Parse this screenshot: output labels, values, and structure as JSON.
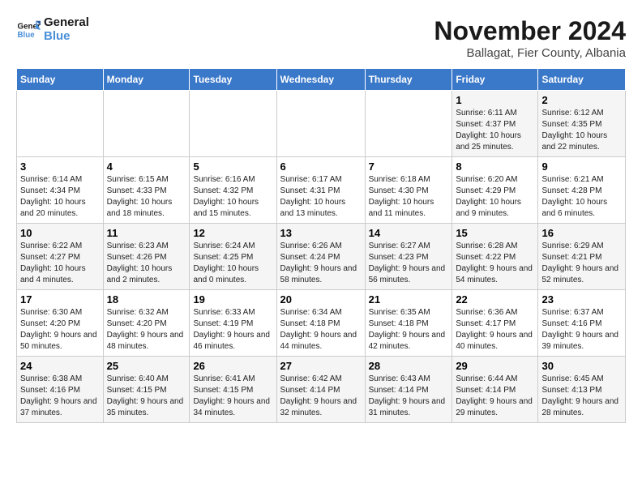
{
  "logo": {
    "line1": "General",
    "line2": "Blue"
  },
  "title": "November 2024",
  "subtitle": "Ballagat, Fier County, Albania",
  "days_header": [
    "Sunday",
    "Monday",
    "Tuesday",
    "Wednesday",
    "Thursday",
    "Friday",
    "Saturday"
  ],
  "weeks": [
    [
      {
        "day": "",
        "info": ""
      },
      {
        "day": "",
        "info": ""
      },
      {
        "day": "",
        "info": ""
      },
      {
        "day": "",
        "info": ""
      },
      {
        "day": "",
        "info": ""
      },
      {
        "day": "1",
        "info": "Sunrise: 6:11 AM\nSunset: 4:37 PM\nDaylight: 10 hours and 25 minutes."
      },
      {
        "day": "2",
        "info": "Sunrise: 6:12 AM\nSunset: 4:35 PM\nDaylight: 10 hours and 22 minutes."
      }
    ],
    [
      {
        "day": "3",
        "info": "Sunrise: 6:14 AM\nSunset: 4:34 PM\nDaylight: 10 hours and 20 minutes."
      },
      {
        "day": "4",
        "info": "Sunrise: 6:15 AM\nSunset: 4:33 PM\nDaylight: 10 hours and 18 minutes."
      },
      {
        "day": "5",
        "info": "Sunrise: 6:16 AM\nSunset: 4:32 PM\nDaylight: 10 hours and 15 minutes."
      },
      {
        "day": "6",
        "info": "Sunrise: 6:17 AM\nSunset: 4:31 PM\nDaylight: 10 hours and 13 minutes."
      },
      {
        "day": "7",
        "info": "Sunrise: 6:18 AM\nSunset: 4:30 PM\nDaylight: 10 hours and 11 minutes."
      },
      {
        "day": "8",
        "info": "Sunrise: 6:20 AM\nSunset: 4:29 PM\nDaylight: 10 hours and 9 minutes."
      },
      {
        "day": "9",
        "info": "Sunrise: 6:21 AM\nSunset: 4:28 PM\nDaylight: 10 hours and 6 minutes."
      }
    ],
    [
      {
        "day": "10",
        "info": "Sunrise: 6:22 AM\nSunset: 4:27 PM\nDaylight: 10 hours and 4 minutes."
      },
      {
        "day": "11",
        "info": "Sunrise: 6:23 AM\nSunset: 4:26 PM\nDaylight: 10 hours and 2 minutes."
      },
      {
        "day": "12",
        "info": "Sunrise: 6:24 AM\nSunset: 4:25 PM\nDaylight: 10 hours and 0 minutes."
      },
      {
        "day": "13",
        "info": "Sunrise: 6:26 AM\nSunset: 4:24 PM\nDaylight: 9 hours and 58 minutes."
      },
      {
        "day": "14",
        "info": "Sunrise: 6:27 AM\nSunset: 4:23 PM\nDaylight: 9 hours and 56 minutes."
      },
      {
        "day": "15",
        "info": "Sunrise: 6:28 AM\nSunset: 4:22 PM\nDaylight: 9 hours and 54 minutes."
      },
      {
        "day": "16",
        "info": "Sunrise: 6:29 AM\nSunset: 4:21 PM\nDaylight: 9 hours and 52 minutes."
      }
    ],
    [
      {
        "day": "17",
        "info": "Sunrise: 6:30 AM\nSunset: 4:20 PM\nDaylight: 9 hours and 50 minutes."
      },
      {
        "day": "18",
        "info": "Sunrise: 6:32 AM\nSunset: 4:20 PM\nDaylight: 9 hours and 48 minutes."
      },
      {
        "day": "19",
        "info": "Sunrise: 6:33 AM\nSunset: 4:19 PM\nDaylight: 9 hours and 46 minutes."
      },
      {
        "day": "20",
        "info": "Sunrise: 6:34 AM\nSunset: 4:18 PM\nDaylight: 9 hours and 44 minutes."
      },
      {
        "day": "21",
        "info": "Sunrise: 6:35 AM\nSunset: 4:18 PM\nDaylight: 9 hours and 42 minutes."
      },
      {
        "day": "22",
        "info": "Sunrise: 6:36 AM\nSunset: 4:17 PM\nDaylight: 9 hours and 40 minutes."
      },
      {
        "day": "23",
        "info": "Sunrise: 6:37 AM\nSunset: 4:16 PM\nDaylight: 9 hours and 39 minutes."
      }
    ],
    [
      {
        "day": "24",
        "info": "Sunrise: 6:38 AM\nSunset: 4:16 PM\nDaylight: 9 hours and 37 minutes."
      },
      {
        "day": "25",
        "info": "Sunrise: 6:40 AM\nSunset: 4:15 PM\nDaylight: 9 hours and 35 minutes."
      },
      {
        "day": "26",
        "info": "Sunrise: 6:41 AM\nSunset: 4:15 PM\nDaylight: 9 hours and 34 minutes."
      },
      {
        "day": "27",
        "info": "Sunrise: 6:42 AM\nSunset: 4:14 PM\nDaylight: 9 hours and 32 minutes."
      },
      {
        "day": "28",
        "info": "Sunrise: 6:43 AM\nSunset: 4:14 PM\nDaylight: 9 hours and 31 minutes."
      },
      {
        "day": "29",
        "info": "Sunrise: 6:44 AM\nSunset: 4:14 PM\nDaylight: 9 hours and 29 minutes."
      },
      {
        "day": "30",
        "info": "Sunrise: 6:45 AM\nSunset: 4:13 PM\nDaylight: 9 hours and 28 minutes."
      }
    ]
  ]
}
